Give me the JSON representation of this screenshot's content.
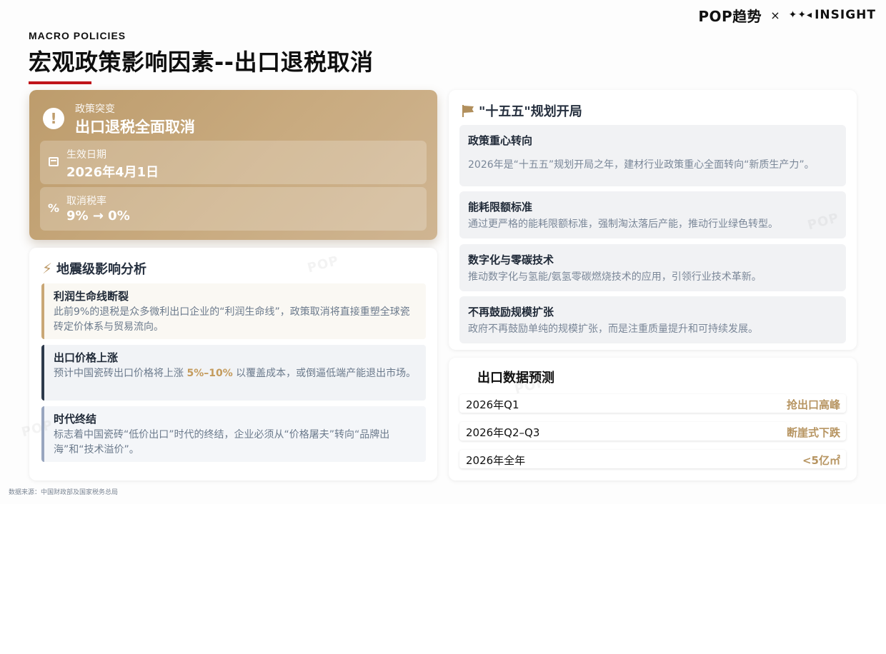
{
  "brand": {
    "pop": "POP趋势",
    "cross": "×",
    "sparks": "✦✦◂",
    "insight": "INSIGHT"
  },
  "header": {
    "kicker": "MACRO POLICIES",
    "title": "宏观政策影响因素--出口退税取消",
    "accent_color": "#c0141a"
  },
  "hero": {
    "icon": "alert-circle-icon",
    "sub_label": "政策突变",
    "main_label": "出口退税全面取消",
    "rows": [
      {
        "icon": "calendar-icon",
        "label": "生效日期",
        "value": "2026年4月1日"
      },
      {
        "icon": "percent-icon",
        "label": "取消税率",
        "value": "9% → 0%"
      }
    ],
    "color": "#c3a476"
  },
  "analysis": {
    "title": "地震级影响分析",
    "icon": "lightning-icon",
    "items": [
      {
        "title": "利润生命线断裂",
        "desc": "此前9%的退税是众多微利出口企业的“利润生命线”，政策取消将直接重塑全球瓷砖定价体系与贸易流向。"
      },
      {
        "title": "出口价格上涨",
        "desc_pre": "预计中国瓷砖出口价格将上涨 ",
        "desc_highlight": "5%–10%",
        "desc_post": " 以覆盖成本，或倒逼低端产能退出市场。"
      },
      {
        "title": "时代终结",
        "desc": "标志着中国瓷砖“低价出口”时代的终结，企业必须从“价格屠夫”转向“品牌出海”和“技术溢价”。"
      }
    ]
  },
  "plan": {
    "title": "\"十五五\"规划开局",
    "icon": "flag-icon",
    "items": [
      {
        "title": "政策重心转向",
        "desc": "2026年是“十五五”规划开局之年，建材行业政策重心全面转向“新质生产力”。"
      },
      {
        "title": "能耗限额标准",
        "desc": "通过更严格的能耗限额标准，强制淘汰落后产能，推动行业绿色转型。"
      },
      {
        "title": "数字化与零碳技术",
        "desc": "推动数字化与氢能/氨氢零碳燃烧技术的应用，引领行业技术革新。"
      },
      {
        "title": "不再鼓励规模扩张",
        "desc": "政府不再鼓励单纯的规模扩张，而是注重质量提升和可持续发展。"
      }
    ]
  },
  "forecast": {
    "title": "出口数据预测",
    "rows": [
      {
        "period": "2026年Q1",
        "value": "抢出口高峰"
      },
      {
        "period": "2026年Q2–Q3",
        "value": "断崖式下跌"
      },
      {
        "period": "2026年全年",
        "value": "<5亿㎡"
      }
    ],
    "value_color": "#b79562"
  },
  "source": "数据来源：中国财政部及国家税务总局"
}
